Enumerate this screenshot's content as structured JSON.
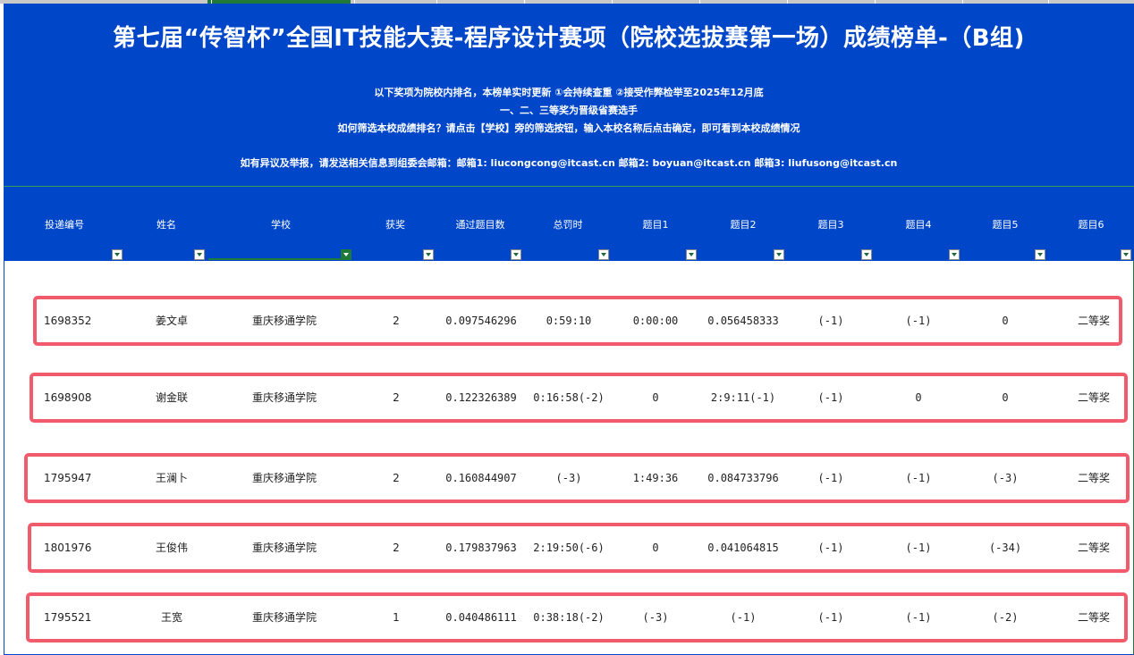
{
  "banner": {
    "title": "第七届“传智杯”全国IT技能大赛-程序设计赛项（院校选拔赛第一场）成绩榜单-（B组)",
    "note1": "以下奖项为院校内排名，本榜单实时更新  ①会持续查重  ②接受作弊检举至2025年12月底",
    "note2": "一、二、三等奖为晋级省赛选手",
    "note3": "如何筛选本校成绩排名？请点击【学校】旁的筛选按钮，输入本校名称后点击确定，即可看到本校成绩情况",
    "contact": "如有异议及举报，请发送相关信息到组委会邮箱：邮箱1: liucongcong@itcast.cn 邮箱2: boyuan@itcast.cn 邮箱3: liufusong@itcast.cn"
  },
  "columns": [
    "投递编号",
    "姓名",
    "学校",
    "获奖",
    "通过题目数",
    "总罚时",
    "题目1",
    "题目2",
    "题目3",
    "题目4",
    "题目5",
    "题目6"
  ],
  "rows": [
    [
      "1698352",
      "姜文卓",
      "重庆移通学院",
      "2",
      "0.097546296",
      "0:59:10",
      "0:00:00",
      "0.056458333",
      "(-1)",
      "(-1)",
      "0",
      "二等奖"
    ],
    [
      "1698908",
      "谢金联",
      "重庆移通学院",
      "2",
      "0.122326389",
      "0:16:58(-2)",
      "0",
      "2:9:11(-1)",
      "(-1)",
      "0",
      "0",
      "二等奖"
    ],
    [
      "1795947",
      "王澜卜",
      "重庆移通学院",
      "2",
      "0.160844907",
      "(-3)",
      "1:49:36",
      "0.084733796",
      "(-1)",
      "(-1)",
      "(-3)",
      "二等奖"
    ],
    [
      "1801976",
      "王俊伟",
      "重庆移通学院",
      "2",
      "0.179837963",
      "2:19:50(-6)",
      "0",
      "0.041064815",
      "(-1)",
      "(-1)",
      "(-34)",
      "二等奖"
    ],
    [
      "1795521",
      "王宽",
      "重庆移通学院",
      "1",
      "0.040486111",
      "0:38:18(-2)",
      "(-3)",
      "(-1)",
      "(-1)",
      "(-1)",
      "(-2)",
      "二等奖"
    ]
  ]
}
